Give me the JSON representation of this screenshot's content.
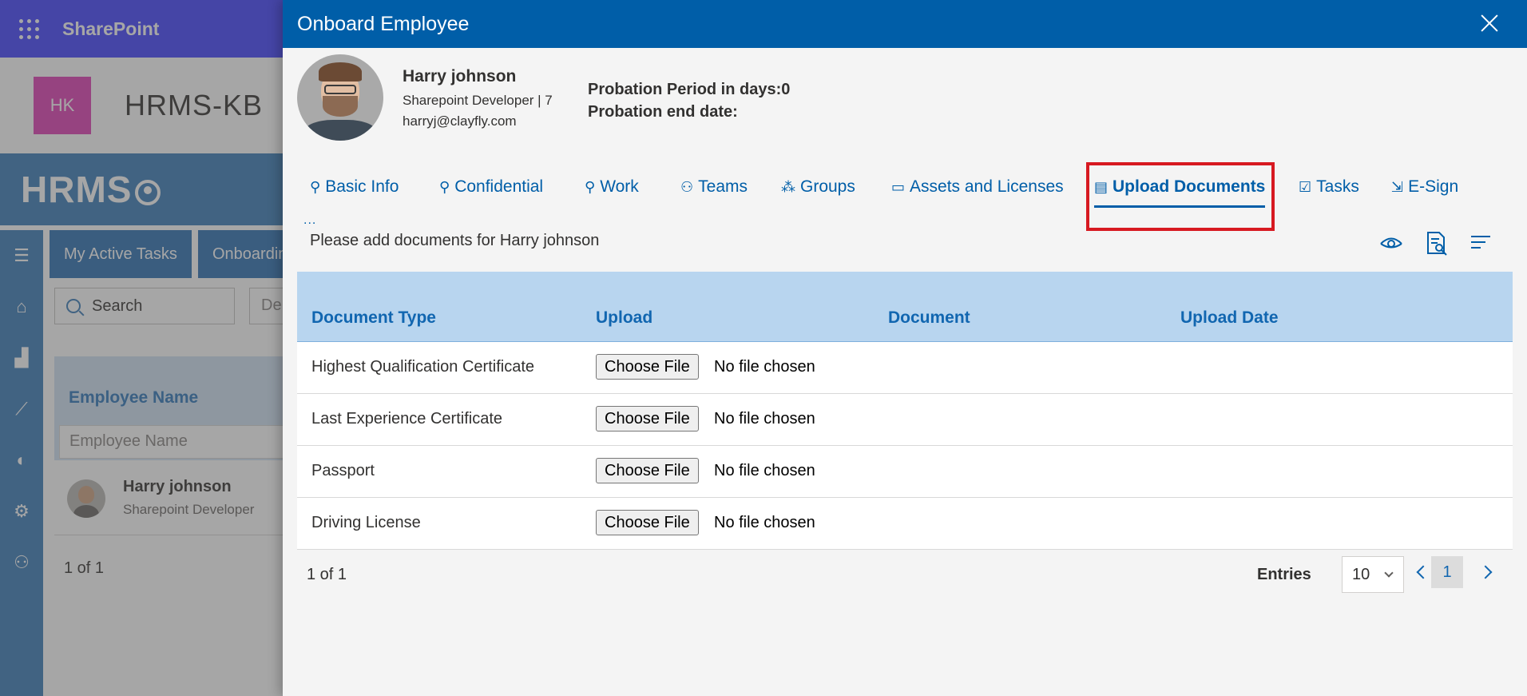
{
  "suite": {
    "title": "SharePoint"
  },
  "site": {
    "logo_initials": "HK",
    "name": "HRMS-KB"
  },
  "hrms": {
    "logo_text": "HRMS"
  },
  "background": {
    "tabs": [
      "My Active Tasks",
      "Onboardin"
    ],
    "search_placeholder": "Search",
    "select_value": "De",
    "column_header": "Employee Name",
    "filter_placeholder": "Employee Name",
    "row": {
      "name": "Harry johnson",
      "role": "Sharepoint Developer"
    },
    "pager": "1 of 1"
  },
  "panel": {
    "title": "Onboard Employee",
    "employee": {
      "name": "Harry johnson",
      "role": "Sharepoint Developer | 7",
      "email": "harryj@clayfly.com",
      "probation_days": "Probation Period in days:0",
      "probation_end": "Probation end date:"
    },
    "tabs": [
      {
        "label": "Basic Info",
        "icon": "person-info-icon"
      },
      {
        "label": "Confidential",
        "icon": "person-lock-icon"
      },
      {
        "label": "Work",
        "icon": "person-work-icon"
      },
      {
        "label": "Teams",
        "icon": "people-icon"
      },
      {
        "label": "Groups",
        "icon": "group-icon"
      },
      {
        "label": "Assets and Licenses",
        "icon": "briefcase-icon"
      },
      {
        "label": "Upload Documents",
        "icon": "document-icon",
        "active": true
      },
      {
        "label": "Tasks",
        "icon": "checkbox-icon"
      },
      {
        "label": "E-Sign",
        "icon": "sign-icon"
      }
    ],
    "tab_more": "...",
    "docs_message": "Please add documents for Harry johnson",
    "table": {
      "headers": [
        "Document Type",
        "Upload",
        "Document",
        "Upload Date"
      ],
      "rows": [
        {
          "type": "Highest Qualification Certificate",
          "button": "Choose File",
          "file": "No file chosen"
        },
        {
          "type": "Last Experience Certificate",
          "button": "Choose File",
          "file": "No file chosen"
        },
        {
          "type": "Passport",
          "button": "Choose File",
          "file": "No file chosen"
        },
        {
          "type": "Driving License",
          "button": "Choose File",
          "file": "No file chosen"
        }
      ]
    },
    "pager": {
      "count": "1 of 1",
      "entries_label": "Entries",
      "entries_value": "10",
      "current_page": "1"
    }
  },
  "colors": {
    "suite_bar": "#6b6bff",
    "panel_header": "#005ea8",
    "highlight": "#d71921",
    "table_header": "#b8d5ef"
  }
}
